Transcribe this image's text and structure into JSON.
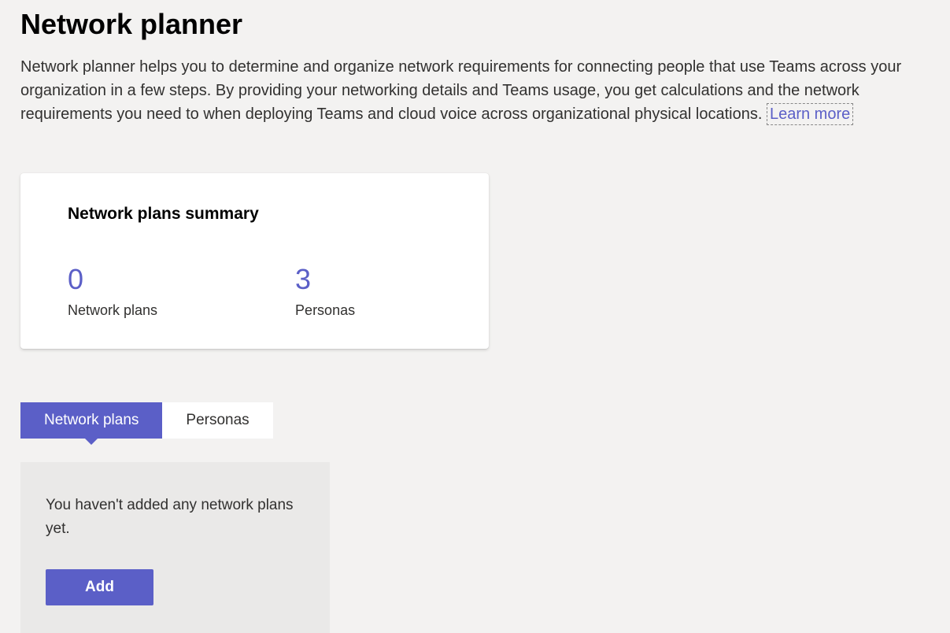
{
  "header": {
    "title": "Network planner",
    "description": "Network planner helps you to determine and organize network requirements for connecting people that use Teams across your organization in a few steps. By providing your networking details and Teams usage, you get calculations and the network requirements you need to when deploying Teams and cloud voice across organizational physical locations. ",
    "learn_more": "Learn more"
  },
  "summary": {
    "title": "Network plans summary",
    "stats": [
      {
        "value": "0",
        "label": "Network plans"
      },
      {
        "value": "3",
        "label": "Personas"
      }
    ]
  },
  "tabs": [
    {
      "label": "Network plans",
      "active": true
    },
    {
      "label": "Personas",
      "active": false
    }
  ],
  "empty_state": {
    "message": "You haven't added any network plans yet.",
    "button_label": "Add"
  }
}
